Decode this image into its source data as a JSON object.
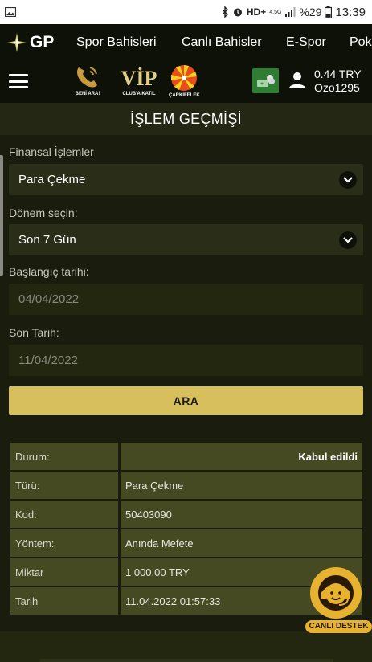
{
  "statusbar": {
    "time": "13:39",
    "battery_pct": "%29",
    "network": "HD+",
    "net_small": "4.5G",
    "icons": [
      "image-icon",
      "bluetooth-icon",
      "alarm-icon",
      "signal-icon",
      "battery-icon"
    ]
  },
  "brand": {
    "name": "GP",
    "logo_icon": "star-icon"
  },
  "nav": {
    "items": [
      "Spor Bahisleri",
      "Canlı Bahisler",
      "E-Spor",
      "Pok"
    ]
  },
  "header": {
    "promos": [
      {
        "caption": "BENİ ARA!",
        "icon": "phone-icon"
      },
      {
        "caption": "CLUB'A KATIL",
        "icon": "vip-icon",
        "text": "VİP"
      },
      {
        "caption": "ÇARKIFELEK",
        "icon": "wheel-icon"
      }
    ],
    "wallet_icon": "money-icon",
    "user_icon": "user-icon",
    "balance": "0.44 TRY",
    "username": "Ozo1295"
  },
  "page": {
    "title": "İŞLEM GEÇMİŞİ"
  },
  "form": {
    "type_label": "Finansal İşlemler",
    "type_value": "Para Çekme",
    "period_label": "Dönem seçin:",
    "period_value": "Son 7 Gün",
    "start_label": "Başlangıç tarihi:",
    "start_value": "04/04/2022",
    "end_label": "Son Tarih:",
    "end_value": "11/04/2022",
    "search_label": "ARA"
  },
  "result": {
    "rows": [
      {
        "key": "Durum:",
        "value": "Kabul edildi"
      },
      {
        "key": "Türü:",
        "value": "Para Çekme"
      },
      {
        "key": "Kod:",
        "value": "50403090"
      },
      {
        "key": "Yöntem:",
        "value": "Anında Mefete"
      },
      {
        "key": "Miktar",
        "value": "1 000.00 TRY"
      },
      {
        "key": "Tarih",
        "value": "11.04.2022 01:57:33"
      }
    ]
  },
  "support": {
    "label": "CANLI DESTEK",
    "icon": "headset-icon"
  },
  "colors": {
    "background": "#1a1d0e",
    "panel": "#454a22",
    "accent": "#d6bf5c",
    "support": "#e7b22f",
    "wallet": "#2e7d32"
  }
}
